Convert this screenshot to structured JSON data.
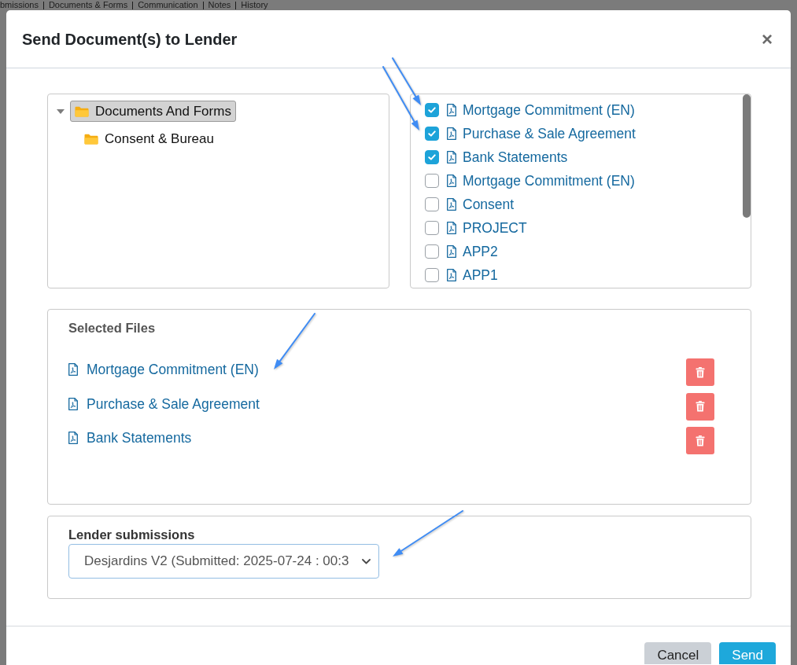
{
  "background_page": {
    "nav_tabs": [
      "bmissions",
      "Documents & Forms",
      "Communication",
      "Notes",
      "History"
    ]
  },
  "dialog": {
    "title": "Send Document(s) to Lender",
    "close_label": "×"
  },
  "folder_tree": {
    "items": [
      {
        "label": "Documents And Forms",
        "selected": true,
        "expanded": true,
        "children": [
          {
            "label": "Consent & Bureau",
            "selected": false
          }
        ]
      }
    ]
  },
  "document_list": {
    "items": [
      {
        "name": "Mortgage Commitment (EN)",
        "checked": true
      },
      {
        "name": "Purchase & Sale Agreement",
        "checked": true
      },
      {
        "name": "Bank Statements",
        "checked": true
      },
      {
        "name": "Mortgage Commitment (EN)",
        "checked": false
      },
      {
        "name": "Consent",
        "checked": false
      },
      {
        "name": "PROJECT",
        "checked": false
      },
      {
        "name": "APP2",
        "checked": false
      },
      {
        "name": "APP1",
        "checked": false
      }
    ]
  },
  "selected_files": {
    "title": "Selected Files",
    "files": [
      {
        "name": "Mortgage Commitment (EN)"
      },
      {
        "name": "Purchase & Sale Agreement"
      },
      {
        "name": "Bank Statements"
      }
    ]
  },
  "lender_submissions": {
    "label": "Lender submissions",
    "value": "Desjardins V2 (Submitted: 2025-07-24 : 00:3"
  },
  "footer_buttons": [
    {
      "label": "Cancel",
      "kind": "secondary"
    },
    {
      "label": "Send",
      "kind": "primary"
    }
  ]
}
